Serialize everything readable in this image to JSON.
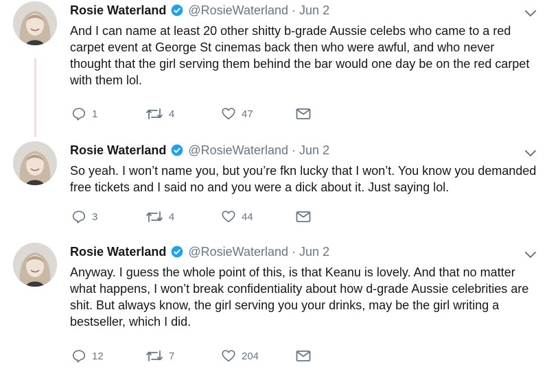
{
  "tweets": [
    {
      "name": "Rosie Waterland",
      "handle": "@RosieWaterland",
      "separator": "·",
      "date": "Jun 2",
      "text": "And I can name at least 20 other shitty b-grade Aussie celebs who came to a red carpet event at George St cinemas back then who were awful, and who never thought that the girl serving them behind the bar would one day be on the red carpet with them lol.",
      "replies": "1",
      "retweets": "4",
      "likes": "47"
    },
    {
      "name": "Rosie Waterland",
      "handle": "@RosieWaterland",
      "separator": "·",
      "date": "Jun 2",
      "text": "So yeah. I won’t name you, but you’re fkn lucky that I won’t. You know you demanded free tickets and I said no and you were a dick about it. Just saying lol.",
      "replies": "3",
      "retweets": "4",
      "likes": "44"
    },
    {
      "name": "Rosie Waterland",
      "handle": "@RosieWaterland",
      "separator": "·",
      "date": "Jun 2",
      "text": "Anyway. I guess the whole point of this, is that Keanu is lovely. And that no matter what happens, I won’t break confidentiality about how d-grade Aussie celebrities are shit. But always know, the girl serving you your drinks, may be the girl writing a bestseller, which I did.",
      "replies": "12",
      "retweets": "7",
      "likes": "204"
    }
  ],
  "icons": {
    "verified": "verified-badge-icon",
    "more": "chevron-down-icon",
    "reply": "reply-icon",
    "retweet": "retweet-icon",
    "like": "heart-icon",
    "message": "envelope-icon"
  },
  "colors": {
    "verified_blue": "#1da1f2",
    "muted": "#657786",
    "thread_line": "#f1d9ee"
  }
}
